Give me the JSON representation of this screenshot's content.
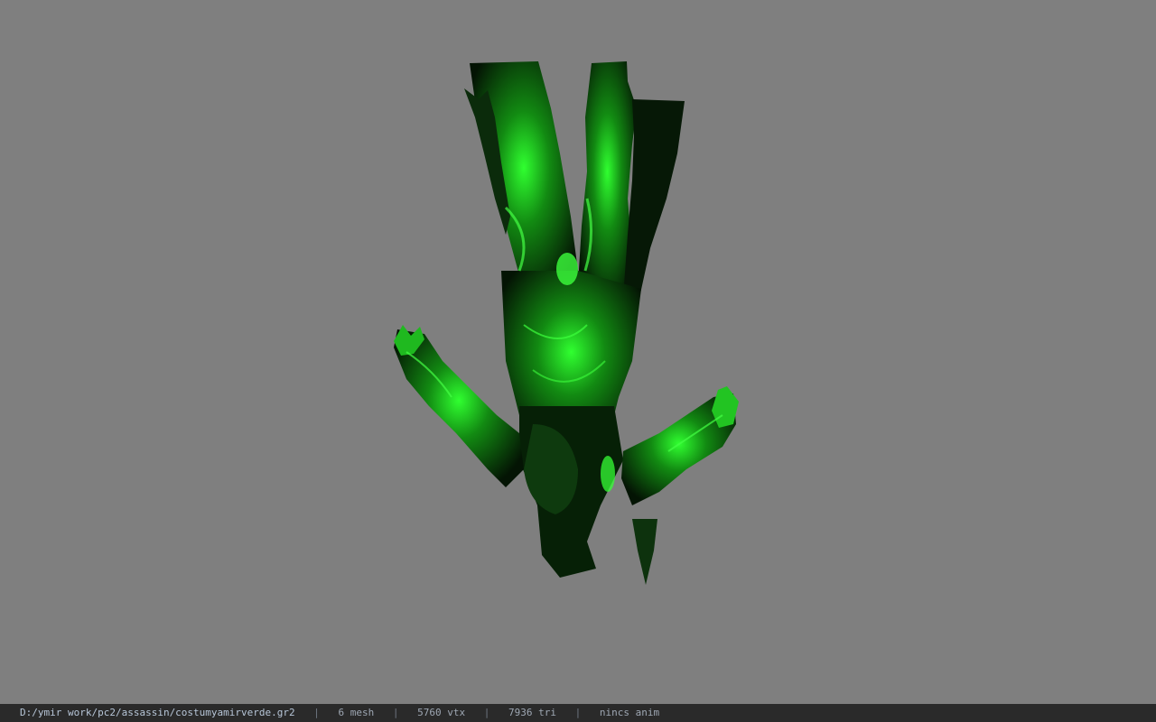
{
  "viewer": {
    "background_color": "#7f7f7f",
    "model_colors": {
      "primary": "#1aa71a",
      "glow": "#2cff2c",
      "shadow": "#031003"
    }
  },
  "status": {
    "path": "D:/ymir work/pc2/assassin/costumyamirverde.gr2",
    "mesh": "6 mesh",
    "vtx": "5760 vtx",
    "tri": "7936 tri",
    "anim": "nincs anim",
    "separator": "|"
  }
}
